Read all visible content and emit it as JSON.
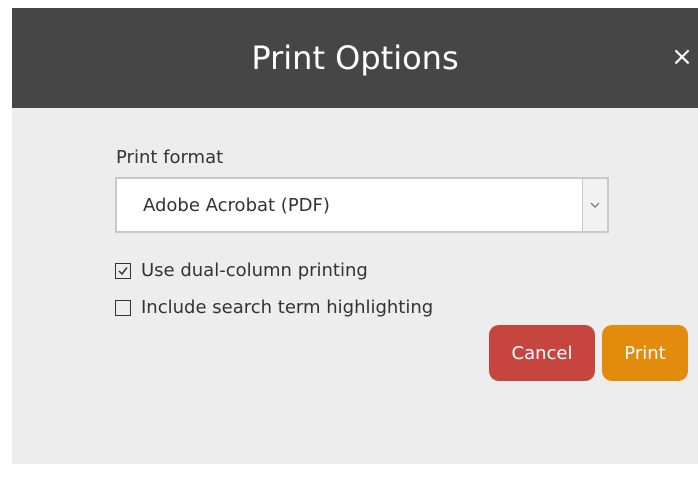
{
  "dialog": {
    "title": "Print Options",
    "close_glyph": "×"
  },
  "print_format": {
    "label": "Print format",
    "selected": "Adobe Acrobat (PDF)"
  },
  "options": [
    {
      "label": "Use dual-column printing",
      "checked": true
    },
    {
      "label": "Include search term highlighting",
      "checked": false
    }
  ],
  "buttons": {
    "cancel": "Cancel",
    "print": "Print"
  },
  "colors": {
    "header_bg": "#464646",
    "body_bg": "#ededed",
    "cancel": "#c6463f",
    "print": "#e38b0d"
  }
}
